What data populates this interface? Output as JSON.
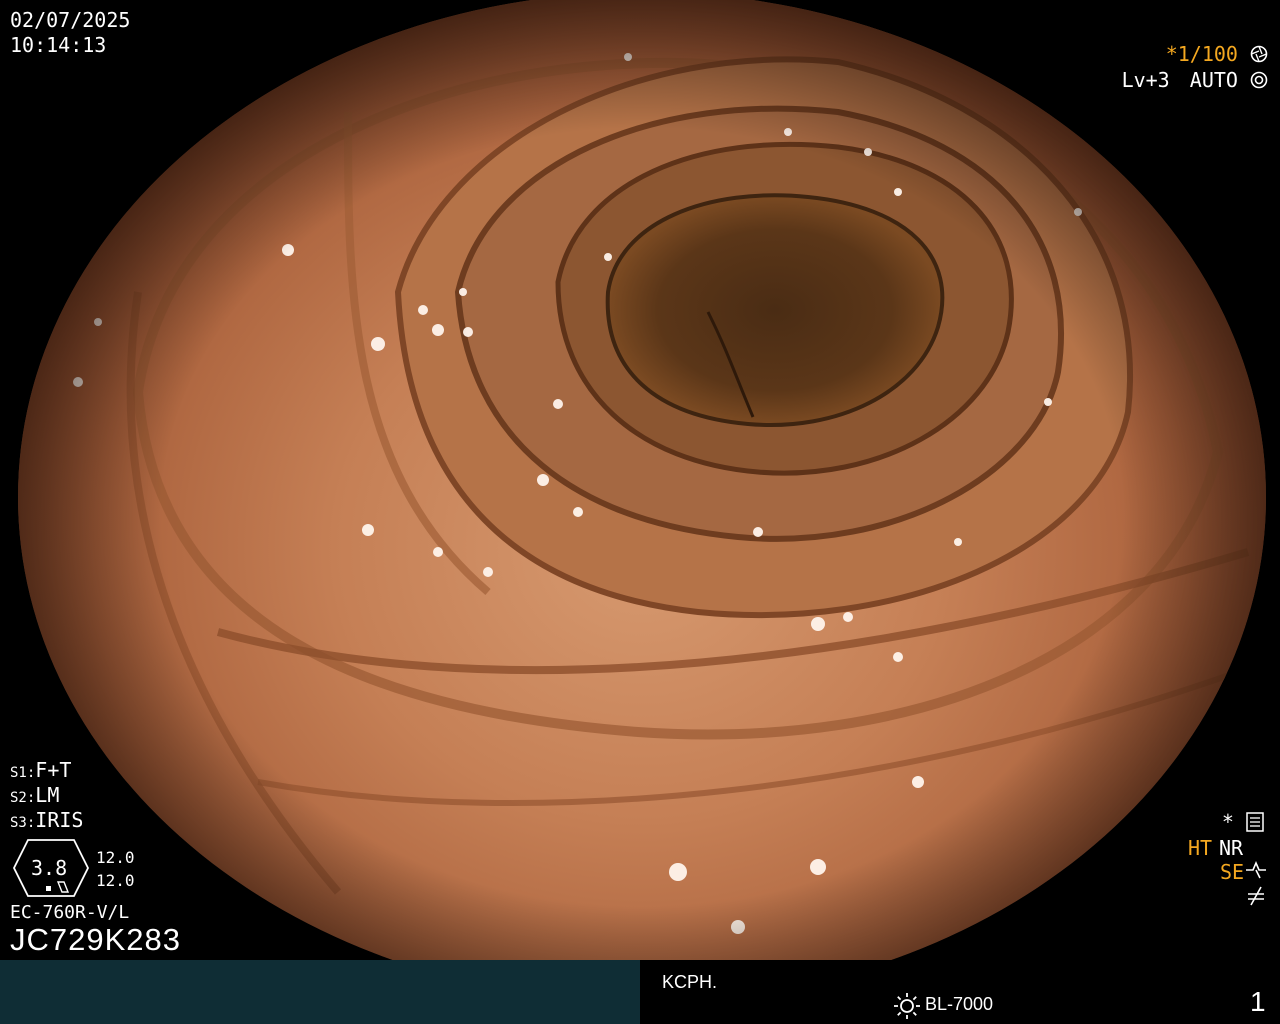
{
  "overlay": {
    "date": "02/07/2025",
    "time": "10:14:13",
    "shutter": "*1/100",
    "level": "Lv+3",
    "mode": "AUTO",
    "settings": {
      "s1_key": "S1:",
      "s1_value": "F+T",
      "s2_key": "S2:",
      "s2_value": "LM",
      "s3_key": "S3:",
      "s3_value": "IRIS"
    },
    "zoom": {
      "value": "3.8",
      "top": "12.0",
      "bottom": "12.0"
    },
    "model": "EC-760R-V/L",
    "serial": "JC729K283",
    "right_labels": {
      "star": "*",
      "ht": "HT",
      "nr": "NR",
      "se": "SE"
    }
  },
  "footer": {
    "institution": "KCPH.",
    "light_source": "BL-7000",
    "page": "1"
  },
  "colors": {
    "amber_text": "#f4a820",
    "panel": "#0f2d35",
    "mucosa": "#c57f55",
    "lumen": "#3a2412"
  },
  "icons": [
    "shutter-icon",
    "auto-iris-icon",
    "settings-icon",
    "se-icon",
    "freeze-icon",
    "light-source-icon"
  ]
}
